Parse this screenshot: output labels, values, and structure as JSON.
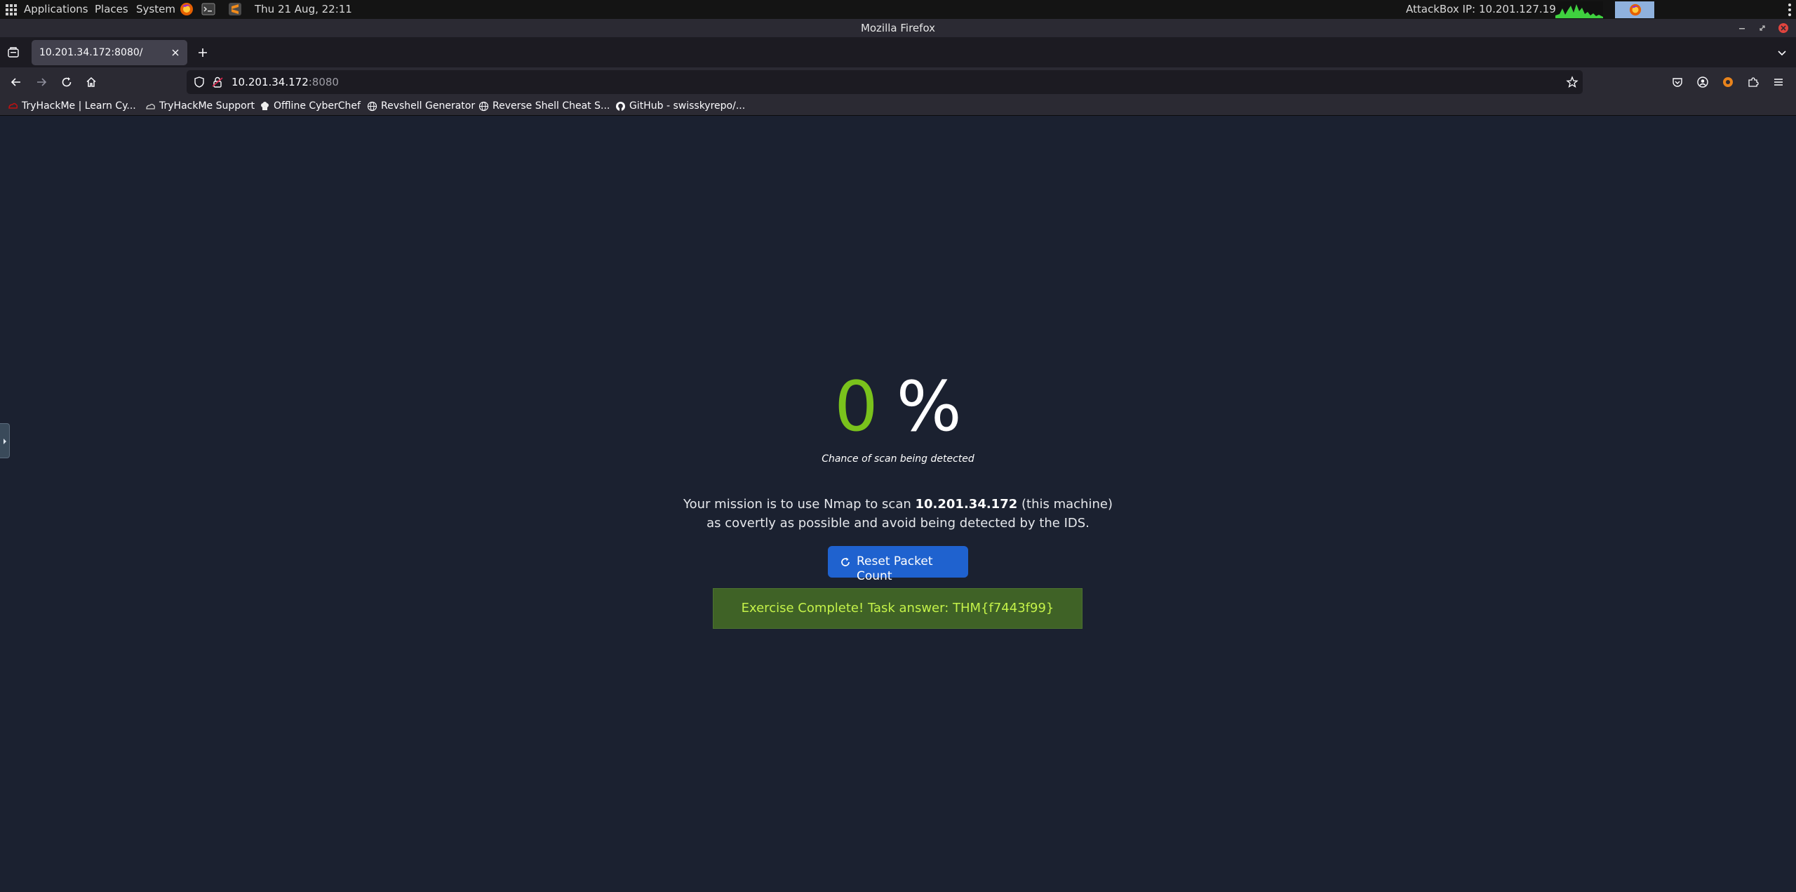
{
  "system_panel": {
    "applications": "Applications",
    "places": "Places",
    "system": "System",
    "datetime": "Thu 21 Aug, 22:11",
    "attackbox_label": "AttackBox IP:",
    "attackbox_ip": "10.201.127.195"
  },
  "window": {
    "title": "Mozilla Firefox"
  },
  "tabs": [
    {
      "title": "10.201.34.172:8080/"
    }
  ],
  "urlbar": {
    "host": "10.201.34.172",
    "port": ":8080"
  },
  "bookmarks": [
    {
      "label": "TryHackMe | Learn Cy...",
      "icon": "tryhackme-icon"
    },
    {
      "label": "TryHackMe Support",
      "icon": "support-icon"
    },
    {
      "label": "Offline CyberChef",
      "icon": "chef-hat-icon"
    },
    {
      "label": "Revshell Generator",
      "icon": "globe-icon"
    },
    {
      "label": "Reverse Shell Cheat S...",
      "icon": "globe-icon"
    },
    {
      "label": "GitHub - swisskyrepo/...",
      "icon": "github-icon"
    }
  ],
  "page": {
    "percent_value": "0",
    "percent_sign": "%",
    "caption": "Chance of scan being detected",
    "mission_prefix": "Your mission is to use Nmap to scan",
    "target_ip": "10.201.34.172",
    "mission_suffix": "(this machine)",
    "mission_line2": "as covertly as possible and avoid being detected by the IDS.",
    "reset_button": "Reset Packet Count",
    "complete_message": "Exercise Complete! Task answer: THM{f7443f99}"
  },
  "colors": {
    "page_bg": "#1b2130",
    "percent_green": "#7ac21c",
    "reset_button_bg": "#1f62cf",
    "complete_bg": "#3f6226",
    "complete_text": "#c4f249"
  }
}
